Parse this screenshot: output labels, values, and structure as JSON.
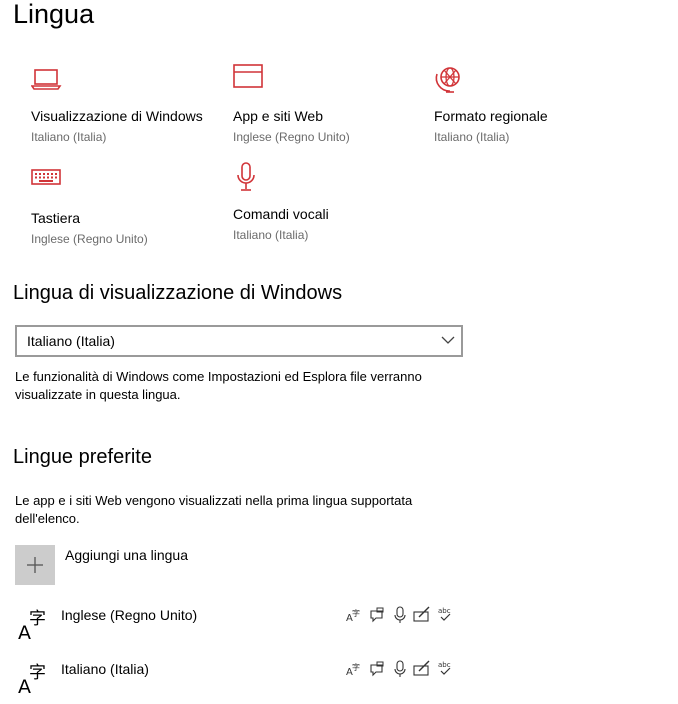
{
  "page": {
    "title": "Lingua"
  },
  "tiles": [
    {
      "title": "Visualizzazione di Windows",
      "subtitle": "Italiano (Italia)",
      "icon": "laptop-icon"
    },
    {
      "title": "App e siti Web",
      "subtitle": "Inglese (Regno Unito)",
      "icon": "browser-window-icon"
    },
    {
      "title": "Formato regionale",
      "subtitle": "Italiano (Italia)",
      "icon": "globe-clock-icon"
    },
    {
      "title": "Tastiera",
      "subtitle": "Inglese (Regno Unito)",
      "icon": "keyboard-icon"
    },
    {
      "title": "Comandi vocali",
      "subtitle": "Italiano (Italia)",
      "icon": "microphone-icon"
    }
  ],
  "display_language": {
    "heading": "Lingua di visualizzazione di Windows",
    "selected": "Italiano (Italia)",
    "description": "Le funzionalità di Windows come Impostazioni ed Esplora file verranno visualizzate in questa lingua."
  },
  "preferred": {
    "heading": "Lingue preferite",
    "description": "Le app e i siti Web vengono visualizzati nella prima lingua supportata dell'elenco.",
    "add_label": "Aggiungi una lingua",
    "languages": [
      {
        "name": "Inglese (Regno Unito)"
      },
      {
        "name": "Italiano (Italia)"
      }
    ],
    "feature_icons": [
      "language-pack-icon",
      "speech-bubble-icon",
      "microphone-icon",
      "handwriting-icon",
      "spellcheck-icon"
    ]
  },
  "colors": {
    "accent": "#d13438",
    "subtext": "#6b6b6b",
    "add_button_bg": "#cccccc",
    "border": "#9a9a9a"
  }
}
